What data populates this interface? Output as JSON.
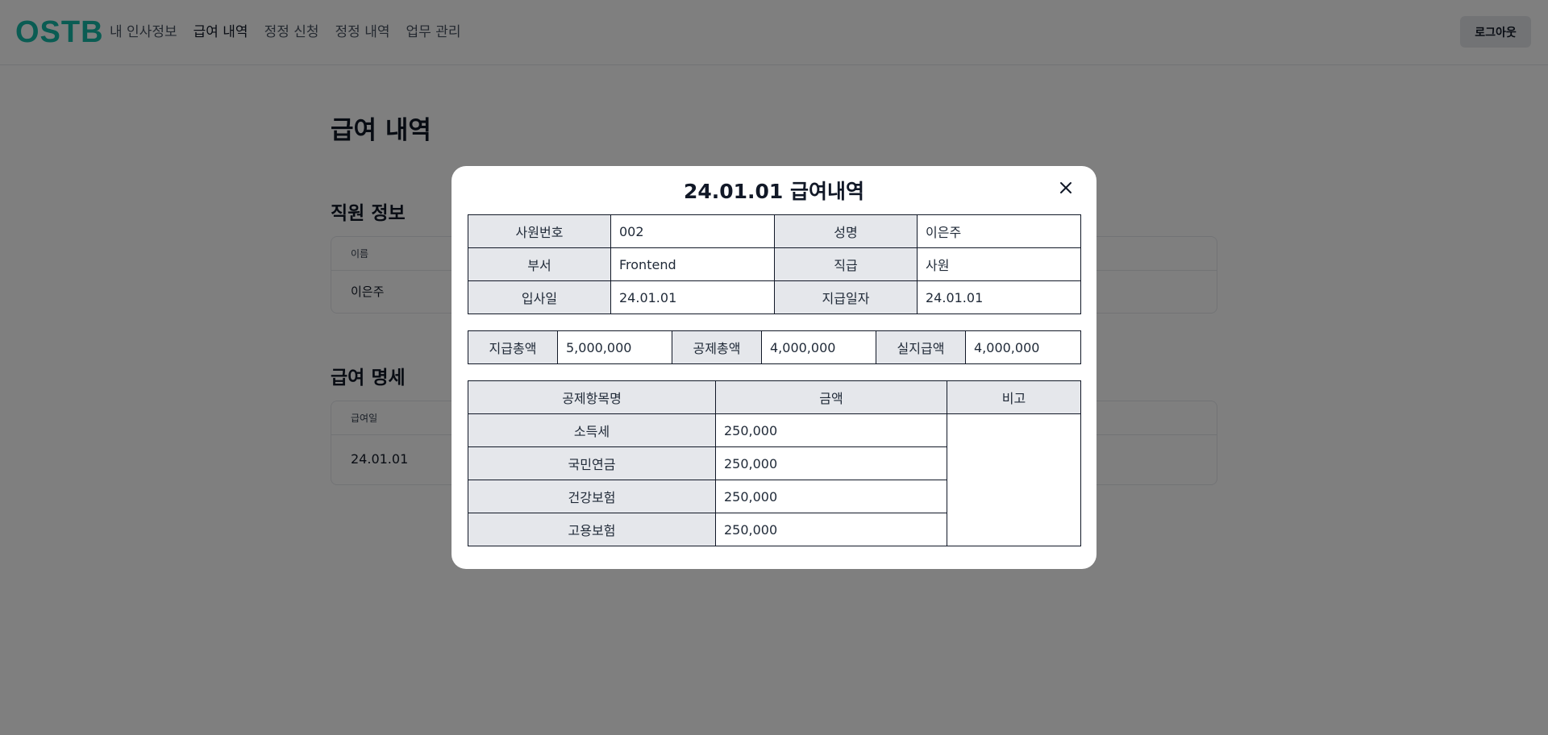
{
  "header": {
    "logo": "OSTB",
    "nav": [
      "내 인사정보",
      "급여 내역",
      "정정 신청",
      "정정 내역",
      "업무 관리"
    ],
    "logout": "로그아웃"
  },
  "page": {
    "title": "급여 내역",
    "employee_section": {
      "title": "직원 정보",
      "header": "이름",
      "value": "이은주"
    },
    "payslip_section": {
      "title": "급여 명세",
      "header": "급여일",
      "value": "24.01.01"
    }
  },
  "modal": {
    "title": "24.01.01 급여내역",
    "close_icon": "close-icon",
    "info": {
      "emp_no_label": "사원번호",
      "emp_no": "002",
      "name_label": "성명",
      "name": "이은주",
      "dept_label": "부서",
      "dept": "Frontend",
      "position_label": "직급",
      "position": "사원",
      "join_label": "입사일",
      "join_date": "24.01.01",
      "pay_date_label": "지급일자",
      "pay_date": "24.01.01"
    },
    "totals": {
      "gross_label": "지급총액",
      "gross": "5,000,000",
      "deduct_label": "공제총액",
      "deduct": "4,000,000",
      "net_label": "실지급액",
      "net": "4,000,000"
    },
    "deductions": {
      "headers": [
        "공제항목명",
        "금액",
        "비고"
      ],
      "rows": [
        {
          "name": "소득세",
          "amount": "250,000"
        },
        {
          "name": "국민연금",
          "amount": "250,000"
        },
        {
          "name": "건강보험",
          "amount": "250,000"
        },
        {
          "name": "고용보험",
          "amount": "250,000"
        }
      ]
    }
  },
  "colors": {
    "brand": "#14b8a6",
    "overlay": "rgba(0,0,0,0.5)",
    "label_bg": "#e5e7eb"
  }
}
